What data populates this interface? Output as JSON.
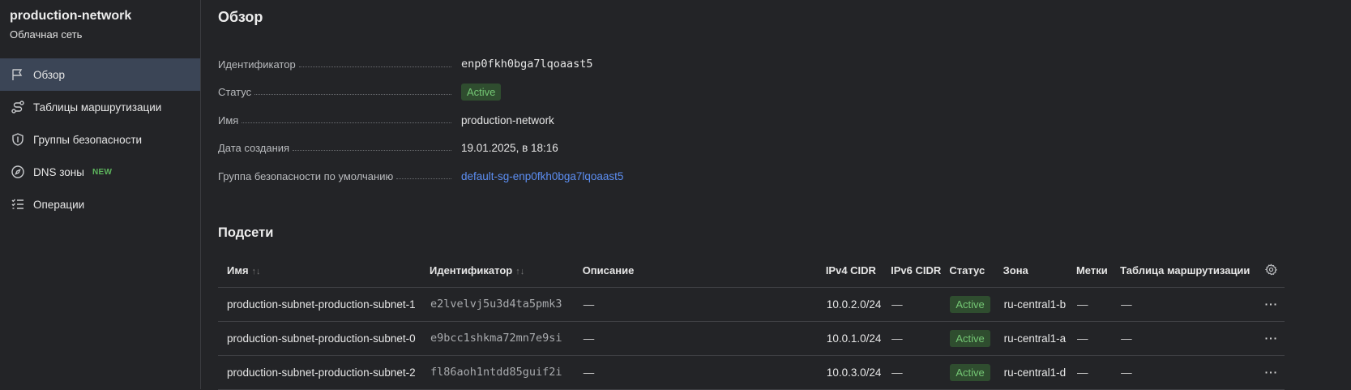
{
  "sidebar": {
    "title": "production-network",
    "subtitle": "Облачная сеть",
    "items": [
      {
        "label": "Обзор",
        "icon": "flag-icon",
        "active": true
      },
      {
        "label": "Таблицы маршрутизации",
        "icon": "route-icon"
      },
      {
        "label": "Группы безопасности",
        "icon": "shield-icon"
      },
      {
        "label": "DNS зоны",
        "icon": "compass-icon",
        "badge": "NEW"
      },
      {
        "label": "Операции",
        "icon": "list-check-icon"
      }
    ]
  },
  "overview": {
    "title": "Обзор",
    "id_label": "Идентификатор",
    "id_value": "enp0fkh0bga7lqoaast5",
    "status_label": "Статус",
    "status_value": "Active",
    "name_label": "Имя",
    "name_value": "production-network",
    "created_label": "Дата создания",
    "created_value": "19.01.2025, в 18:16",
    "sg_label": "Группа безопасности по умолчанию",
    "sg_value": "default-sg-enp0fkh0bga7lqoaast5"
  },
  "subnets": {
    "title": "Подсети",
    "columns": {
      "name": "Имя",
      "id": "Идентификатор",
      "description": "Описание",
      "ipv4": "IPv4 CIDR",
      "ipv6": "IPv6 CIDR",
      "status": "Статус",
      "zone": "Зона",
      "labels": "Метки",
      "route_table": "Таблица маршрутизации"
    },
    "rows": [
      {
        "name": "production-subnet-production-subnet-1",
        "id": "e2lvelvj5u3d4ta5pmk3",
        "description": "—",
        "ipv4": "10.0.2.0/24",
        "ipv6": "—",
        "status": "Active",
        "zone": "ru-central1-b",
        "labels": "—",
        "route_table": "—"
      },
      {
        "name": "production-subnet-production-subnet-0",
        "id": "e9bcc1shkma72mn7e9si",
        "description": "—",
        "ipv4": "10.0.1.0/24",
        "ipv6": "—",
        "status": "Active",
        "zone": "ru-central1-a",
        "labels": "—",
        "route_table": "—"
      },
      {
        "name": "production-subnet-production-subnet-2",
        "id": "fl86aoh1ntdd85guif2i",
        "description": "—",
        "ipv4": "10.0.3.0/24",
        "ipv6": "—",
        "status": "Active",
        "zone": "ru-central1-d",
        "labels": "—",
        "route_table": "—"
      }
    ]
  },
  "colors": {
    "background": "#232427",
    "active_nav": "#3b4556",
    "link": "#5c8ef2",
    "status_bg": "#2f4d2f",
    "status_text": "#74c774",
    "new_badge": "#5db55d"
  }
}
